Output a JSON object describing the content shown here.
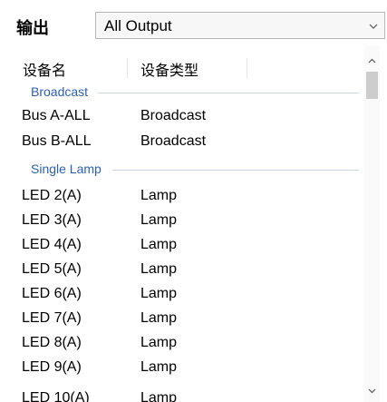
{
  "toolbar": {
    "output_label": "输出",
    "output_selected": "All Output"
  },
  "columns": {
    "name": "设备名",
    "type": "设备类型"
  },
  "groups": [
    {
      "label": "Broadcast"
    },
    {
      "label": "Single Lamp"
    }
  ],
  "broadcast_rows": [
    {
      "name": "Bus A-ALL",
      "type": "Broadcast"
    },
    {
      "name": "Bus B-ALL",
      "type": "Broadcast"
    }
  ],
  "lamp_rows": [
    {
      "name": "LED 2(A)",
      "type": "Lamp"
    },
    {
      "name": "LED 3(A)",
      "type": "Lamp"
    },
    {
      "name": "LED 4(A)",
      "type": "Lamp"
    },
    {
      "name": "LED 5(A)",
      "type": "Lamp"
    },
    {
      "name": "LED 6(A)",
      "type": "Lamp"
    },
    {
      "name": "LED 7(A)",
      "type": "Lamp"
    },
    {
      "name": "LED 8(A)",
      "type": "Lamp"
    },
    {
      "name": "LED 9(A)",
      "type": "Lamp"
    },
    {
      "name": "LED 10(A)",
      "type": "Lamp"
    }
  ],
  "colors": {
    "group_text": "#2b5fb3",
    "group_line": "#c9d4e6",
    "scroll_thumb": "#cdcdcd"
  }
}
